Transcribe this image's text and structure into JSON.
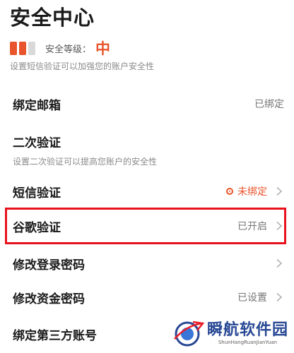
{
  "header": {
    "title": "安全中心"
  },
  "security_level": {
    "label": "安全等级：",
    "value": "中",
    "value_color": "#e8542b",
    "bar_colors": [
      "#e8542b",
      "#e8542b",
      "#d9d9d9"
    ],
    "hint": "设置短信验证可以加强您的账户安全性"
  },
  "items": [
    {
      "title": "绑定邮箱",
      "status": "已绑定"
    },
    {
      "title": "二次验证",
      "subtitle": "设置二次验证可以提高您账户的安全性"
    },
    {
      "title": "短信验证",
      "status": "未绑定",
      "status_color": "#e8542b"
    },
    {
      "title": "谷歌验证",
      "status": "已开启"
    },
    {
      "title": "修改登录密码"
    },
    {
      "title": "修改资金密码",
      "status": "已设置"
    },
    {
      "title": "绑定第三方账号"
    }
  ],
  "colors": {
    "highlight": "#e8121d",
    "chevron": "#b3b3b3"
  },
  "watermark": {
    "text": "瞬航软件园",
    "subtext": "ShunHangRuanJianYuan"
  }
}
